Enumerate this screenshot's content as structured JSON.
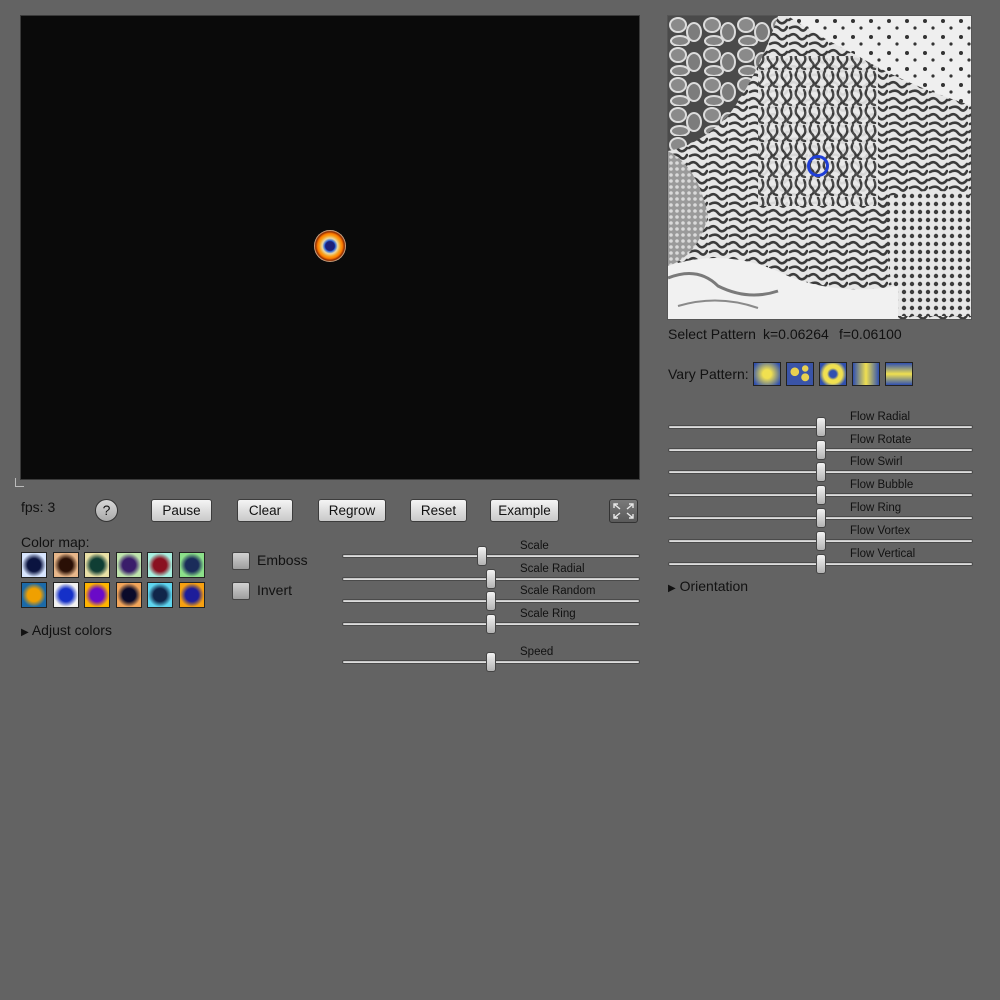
{
  "fps_label": "fps: 3",
  "buttons": {
    "help": "?",
    "pause": "Pause",
    "clear": "Clear",
    "regrow": "Regrow",
    "reset": "Reset",
    "example": "Example"
  },
  "color_map": {
    "label": "Color map:",
    "swatches": [
      {
        "icon": "colormap-navy-icon",
        "inner": "#0b1440",
        "outer": "#d8e6ff"
      },
      {
        "icon": "colormap-brown-icon",
        "inner": "#2a1006",
        "outer": "#e8b78a"
      },
      {
        "icon": "colormap-teal-icon",
        "inner": "#0f3e34",
        "outer": "#e9e0a6"
      },
      {
        "icon": "colormap-purple-icon",
        "inner": "#3a1d6a",
        "outer": "#bfe5ad"
      },
      {
        "icon": "colormap-red-icon",
        "inner": "#8a1020",
        "outer": "#a8f0e0"
      },
      {
        "icon": "colormap-blue-green-icon",
        "inner": "#1a2c5a",
        "outer": "#8ce08a"
      },
      {
        "icon": "colormap-orange-icon",
        "inner": "#f0a000",
        "outer": "#1b6aa8"
      },
      {
        "icon": "colormap-blue-ring-icon",
        "inner": "#1530c8",
        "outer": "#f1f1f1"
      },
      {
        "icon": "colormap-rainbow-icon",
        "inner": "#6a0ac8",
        "outer": "#ffb400"
      },
      {
        "icon": "colormap-dark-blue-icon",
        "inner": "#0a0a2a",
        "outer": "#f2a55a"
      },
      {
        "icon": "colormap-cyan-icon",
        "inner": "#10264a",
        "outer": "#5fd6f0"
      },
      {
        "icon": "colormap-fire-icon",
        "inner": "#1d1d9a",
        "outer": "#f7a010"
      }
    ]
  },
  "options": {
    "emboss": "Emboss",
    "invert": "Invert"
  },
  "adjust_colors": "Adjust colors",
  "sliders_left": [
    {
      "label": "Scale",
      "value": 0.47
    },
    {
      "label": "Scale Radial",
      "value": 0.5
    },
    {
      "label": "Scale Random",
      "value": 0.5
    },
    {
      "label": "Scale Ring",
      "value": 0.5
    },
    {
      "label": "Speed",
      "value": 0.5
    }
  ],
  "pattern": {
    "select_label": "Select Pattern",
    "k": "k=0.06264",
    "f": "f=0.06100"
  },
  "vary": {
    "label": "Vary Pattern:",
    "options": [
      "vary-radial-icon",
      "vary-spots-icon",
      "vary-ring-icon",
      "vary-vertical-icon",
      "vary-horizontal-icon"
    ]
  },
  "flow_sliders": [
    {
      "label": "Flow Radial",
      "value": 0.5
    },
    {
      "label": "Flow Rotate",
      "value": 0.5
    },
    {
      "label": "Flow Swirl",
      "value": 0.5
    },
    {
      "label": "Flow Bubble",
      "value": 0.5
    },
    {
      "label": "Flow Ring",
      "value": 0.5
    },
    {
      "label": "Flow Vortex",
      "value": 0.5
    },
    {
      "label": "Flow Vertical",
      "value": 0.5
    }
  ],
  "orientation": "Orientation",
  "colors": {
    "background": "#636363",
    "canvas": "#0a0a0a",
    "map_cursor": "#1f3fd8"
  }
}
